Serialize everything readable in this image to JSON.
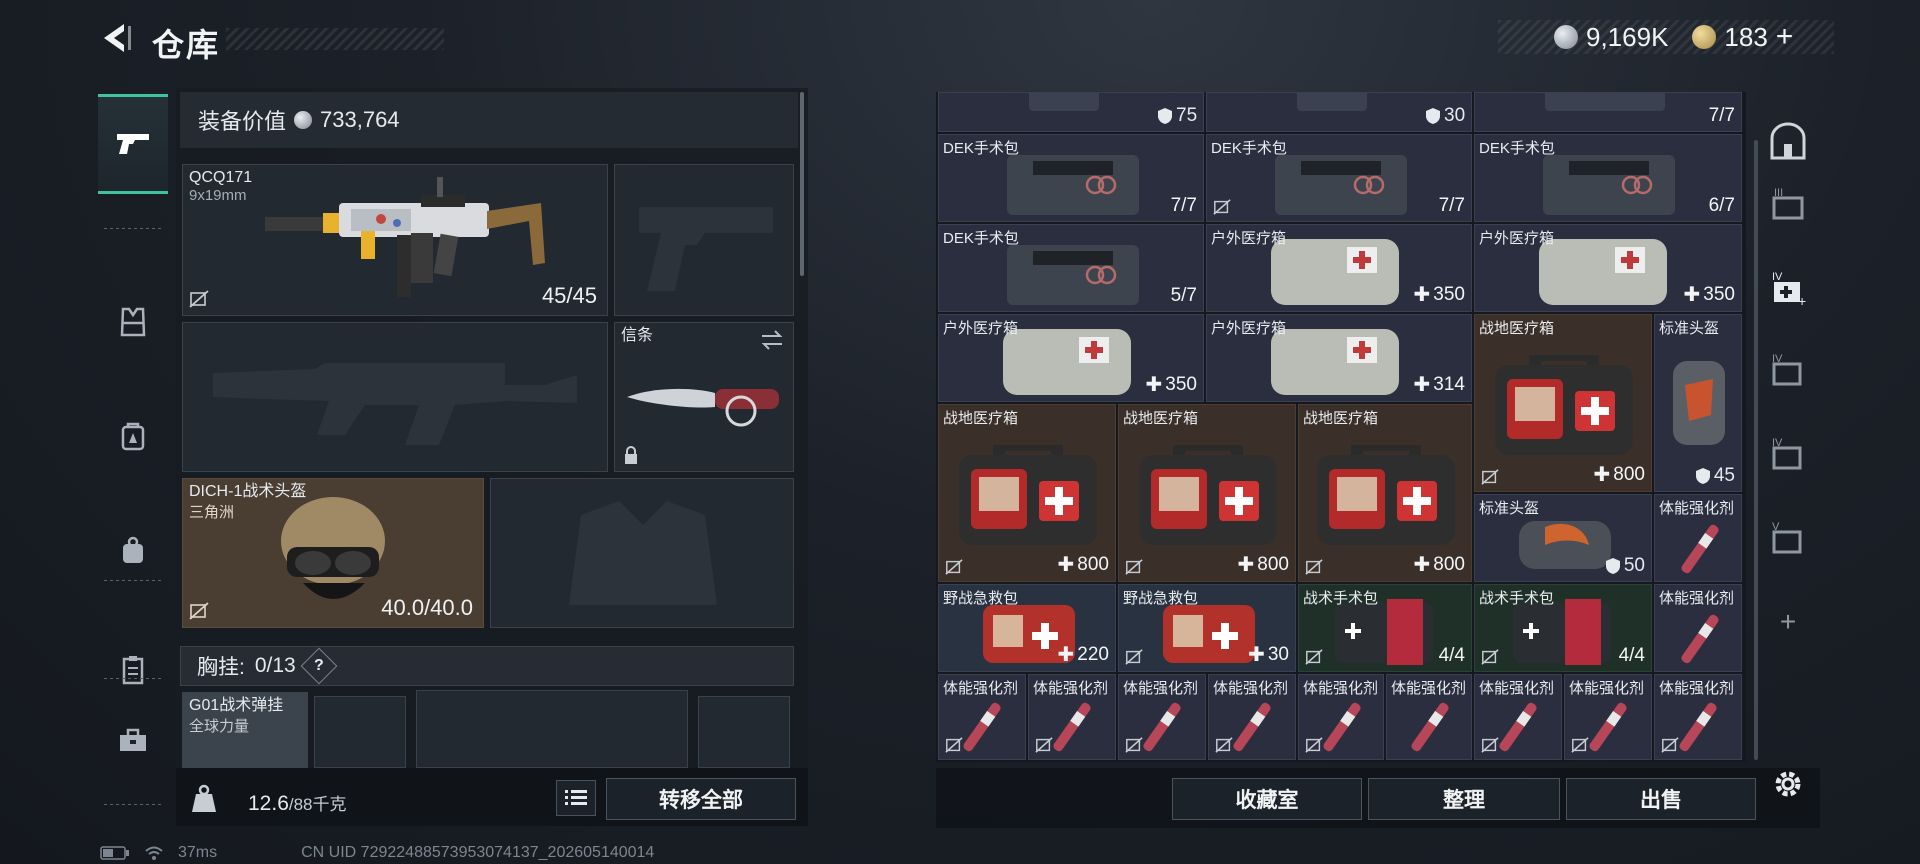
{
  "header": {
    "title": "仓库",
    "currency_1": "9,169K",
    "currency_2": "183",
    "currency_plus": "+"
  },
  "equipment": {
    "value_label": "装备价值",
    "value": "733,764",
    "primary_weapon": {
      "name": "QCQ171",
      "caliber": "9x19mm",
      "ammo": "45/45"
    },
    "melee": {
      "name": "信条"
    },
    "helmet": {
      "name": "DICH-1战术头盔",
      "sub": "三角洲",
      "durability": "40.0/40.0"
    },
    "chest_rig": {
      "label": "胸挂:",
      "capacity": "0/13",
      "help": "?",
      "item_name": "G01战术弹挂",
      "item_sub": "全球力量"
    }
  },
  "footer_left": {
    "weight": "12.6",
    "weight_unit": "/88千克",
    "transfer_all": "转移全部"
  },
  "inventory": {
    "rows": [
      [
        {
          "name": "",
          "value": "75",
          "type": "shield"
        },
        {
          "name": "",
          "value": "30",
          "type": "shield"
        },
        {
          "name": "",
          "value": "7/7",
          "type": "count"
        }
      ],
      [
        {
          "name": "DEK手术包",
          "value": "7/7"
        },
        {
          "name": "DEK手术包",
          "value": "7/7"
        },
        {
          "name": "DEK手术包",
          "value": "6/7"
        }
      ],
      [
        {
          "name": "DEK手术包",
          "value": "5/7"
        },
        {
          "name": "户外医疗箱",
          "value": "350"
        },
        {
          "name": "户外医疗箱",
          "value": "350"
        }
      ],
      [
        {
          "name": "户外医疗箱",
          "value": "350"
        },
        {
          "name": "户外医疗箱",
          "value": "314"
        },
        {
          "name": "战地医疗箱",
          "value": "800"
        },
        {
          "name": "标准头盔",
          "value": "45"
        }
      ],
      [
        {
          "name": "战地医疗箱",
          "value": "800"
        },
        {
          "name": "战地医疗箱",
          "value": "800"
        },
        {
          "name": "战地医疗箱",
          "value": "800"
        },
        {
          "name": "标准头盔",
          "value": "50"
        },
        {
          "name": "体能强化剂",
          "value": ""
        }
      ],
      [
        {
          "name": "野战急救包",
          "value": "220"
        },
        {
          "name": "野战急救包",
          "value": "30"
        },
        {
          "name": "战术手术包",
          "value": "4/4"
        },
        {
          "name": "战术手术包",
          "value": "4/4"
        },
        {
          "name": "体能强化剂",
          "value": ""
        }
      ],
      [
        {
          "name": "体能强化剂"
        },
        {
          "name": "体能强化剂"
        },
        {
          "name": "体能强化剂"
        },
        {
          "name": "体能强化剂"
        },
        {
          "name": "体能强化剂"
        },
        {
          "name": "体能强化剂"
        },
        {
          "name": "体能强化剂"
        },
        {
          "name": "体能强化剂"
        },
        {
          "name": "体能强化剂"
        }
      ]
    ]
  },
  "footer_right": {
    "collection": "收藏室",
    "organize": "整理",
    "sell": "出售"
  },
  "filter_rail": {
    "labels": [
      "III",
      "IV",
      "IV",
      "IV",
      "V"
    ],
    "add": "+"
  },
  "status_bar": {
    "ping": "37ms",
    "uid": "CN UID 7292248857395307413​7_202605140014"
  },
  "colors": {
    "accent_green": "#3fc39a",
    "cell_blue": "#2a2e3f",
    "cell_brown": "#3a2f29",
    "cell_teal": "#1f3029"
  }
}
